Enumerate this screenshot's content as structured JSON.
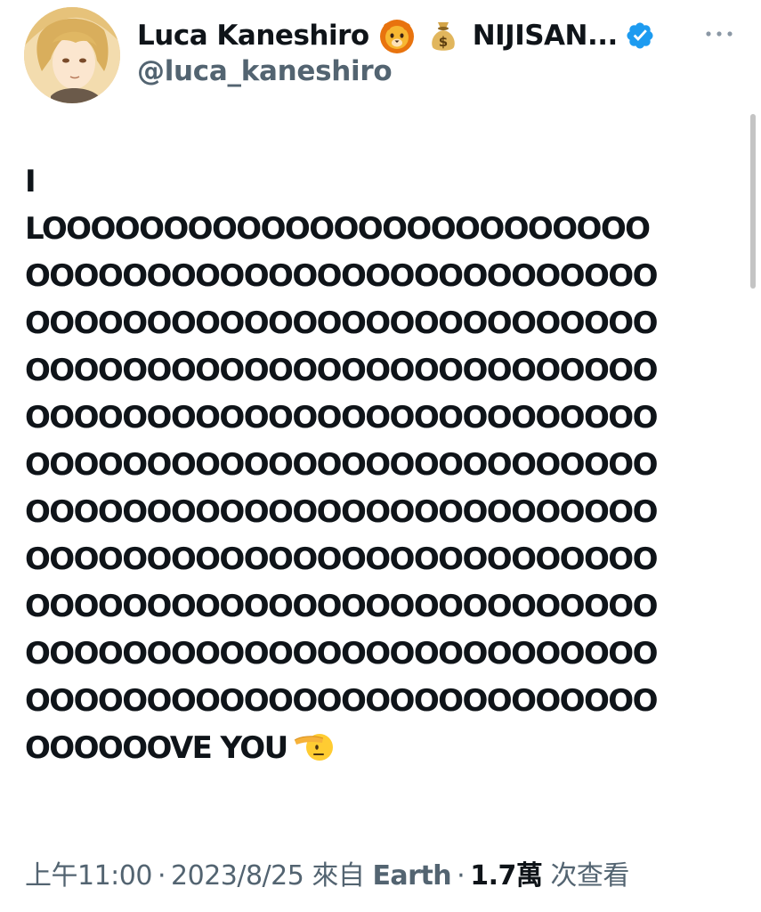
{
  "tweet": {
    "author": {
      "display_name": "Luca Kaneshiro",
      "emoji_badges": [
        "lion-face",
        "money-bag"
      ],
      "affiliation": "NIJISAN...",
      "verified": true,
      "handle": "@luca_kaneshiro"
    },
    "body_lines": [
      "I",
      "LOOOOOOOOOOOOOOOOOOOOOOOOO",
      "OOOOOOOOOOOOOOOOOOOOOOOOOO",
      "OOOOOOOOOOOOOOOOOOOOOOOOOO",
      "OOOOOOOOOOOOOOOOOOOOOOOOOO",
      "OOOOOOOOOOOOOOOOOOOOOOOOOO",
      "OOOOOOOOOOOOOOOOOOOOOOOOOO",
      "OOOOOOOOOOOOOOOOOOOOOOOOOO",
      "OOOOOOOOOOOOOOOOOOOOOOOOOO",
      "OOOOOOOOOOOOOOOOOOOOOOOOOO",
      "OOOOOOOOOOOOOOOOOOOOOOOOOO",
      "OOOOOOOOOOOOOOOOOOOOOOOOOO",
      "OOOOOOVE YOU"
    ],
    "body_trailing_emoji": "saluting-face",
    "meta": {
      "time": "上午11:00",
      "separator": "·",
      "date": "2023/8/25",
      "source_prefix": "來自",
      "source": "Earth",
      "views_count": "1.7萬",
      "views_label": "次查看"
    }
  },
  "icons": {
    "more": "more-horizontal-icon",
    "verified": "verified-badge-icon",
    "verified_color": "#1d9bf0"
  },
  "colors": {
    "text_primary": "#0f1419",
    "text_secondary": "#536471"
  }
}
